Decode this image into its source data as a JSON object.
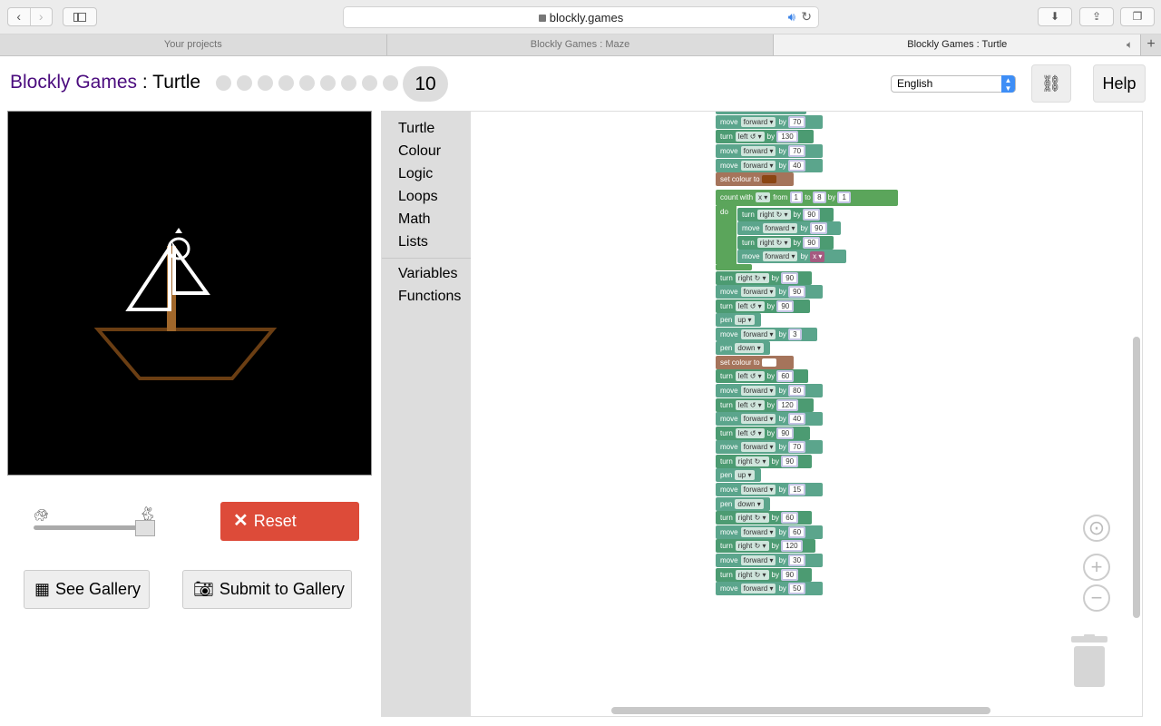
{
  "browser": {
    "url": "blockly.games",
    "tabs": [
      "Your projects",
      "Blockly Games : Maze",
      "Blockly Games : Turtle"
    ],
    "new_tab": "+"
  },
  "header": {
    "brand": "Blockly Games",
    "separator": " : ",
    "page": "Turtle",
    "level": "10",
    "level_dot_count": 9,
    "language": "English",
    "link_icon": "link-icon",
    "help": "Help"
  },
  "controls": {
    "reset": "Reset",
    "see_gallery": "See Gallery",
    "submit_gallery": "Submit to Gallery",
    "speed": 0.9
  },
  "toolbox": {
    "categories": [
      "Turtle",
      "Colour",
      "Logic",
      "Loops",
      "Math",
      "Lists"
    ],
    "dynamic": [
      "Variables",
      "Functions"
    ]
  },
  "colors": {
    "brand": "#4b0c7e",
    "reset": "#dd4b39",
    "turtle_block": "#5ba58c",
    "colour_block": "#a5745b",
    "loop_block": "#5ba55b",
    "variable_block": "#a55b80",
    "sail": "#ffffff",
    "mast": "#a0672b",
    "hull": "#6b3e13"
  },
  "program": {
    "move": "move",
    "turn": "turn",
    "pen": "pen",
    "by": "by",
    "forward": "forward ▾",
    "left": "left ↺ ▾",
    "right": "right ↻ ▾",
    "up": "up ▾",
    "down": "down ▾",
    "set_colour": "set colour to",
    "count_with": "count with",
    "from": "from",
    "to": "to",
    "do": "do",
    "var_x": "x ▾",
    "values": {
      "m1": "70",
      "t1": "130",
      "m2": "70",
      "m3": "40",
      "c_from": "1",
      "c_to": "8",
      "c_by": "1",
      "l1": "90",
      "l2": "90",
      "l3": "90",
      "t2": "90",
      "m4": "90",
      "t3": "90",
      "m5": "3",
      "t4": "60",
      "m6": "80",
      "t5": "120",
      "m7": "40",
      "t6": "90",
      "m8": "70",
      "t7": "90",
      "m9": "15",
      "t8": "60",
      "m10": "60",
      "t9": "120",
      "m11": "30",
      "t10": "90",
      "m12": "50"
    }
  }
}
